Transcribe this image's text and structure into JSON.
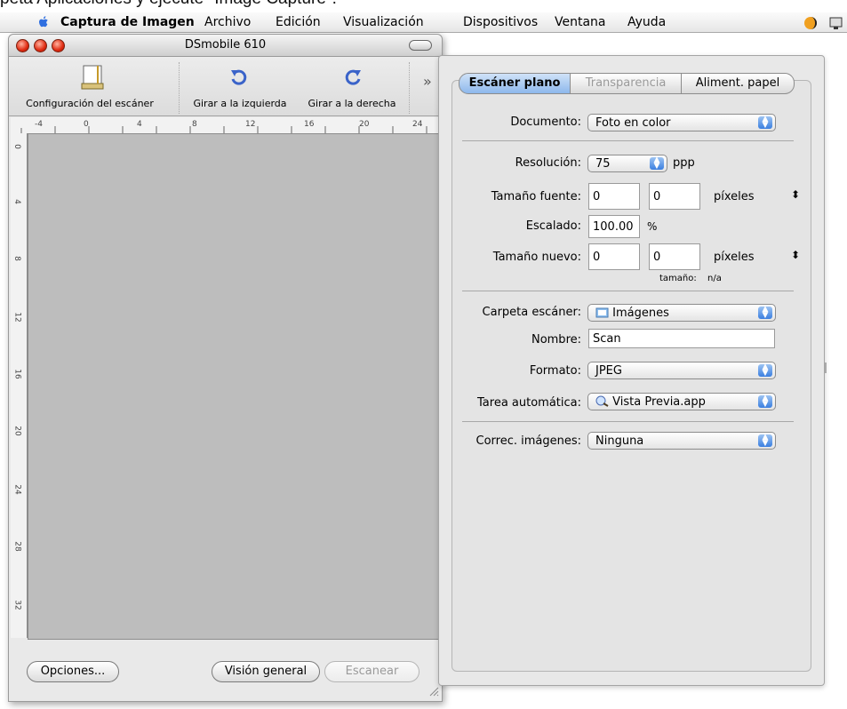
{
  "caption": "peta Aplicaciones y ejecute \"Image Capture\".",
  "menubar": {
    "app": "Captura de Imagen",
    "items": [
      "Archivo",
      "Edición",
      "Visualización",
      "Dispositivos",
      "Ventana",
      "Ayuda"
    ]
  },
  "scanner_window": {
    "title": "DSmobile 610",
    "toolbar": {
      "config": "Configuración del escáner",
      "rotate_left": "Girar a la izquierda",
      "rotate_right": "Girar a la derecha",
      "more": "»"
    },
    "ruler_top": [
      "-4",
      "0",
      "4",
      "8",
      "12",
      "16",
      "20",
      "24"
    ],
    "ruler_left": [
      "0",
      "4",
      "8",
      "12",
      "16",
      "20",
      "24",
      "28",
      "32"
    ],
    "buttons": {
      "options": "Opciones...",
      "overview": "Visión general",
      "scan": "Escanear"
    }
  },
  "settings": {
    "tabs": [
      "Escáner plano",
      "Transparencia",
      "Aliment. papel"
    ],
    "selected_tab": "Escáner plano",
    "document_label": "Documento:",
    "document_value": "Foto en color",
    "resolution_label": "Resolución:",
    "resolution_value": "75",
    "resolution_unit": "ppp",
    "source_size_label": "Tamaño fuente:",
    "source_w": "0",
    "source_h": "0",
    "source_unit": "píxeles",
    "scale_label": "Escalado:",
    "scale_value": "100.00",
    "scale_unit": "%",
    "new_size_label": "Tamaño nuevo:",
    "new_w": "0",
    "new_h": "0",
    "new_unit": "píxeles",
    "size_label": "tamaño:",
    "size_value": "n/a",
    "folder_label": "Carpeta escáner:",
    "folder_value": "Imágenes",
    "name_label": "Nombre:",
    "name_value": "Scan",
    "format_label": "Formato:",
    "format_value": "JPEG",
    "task_label": "Tarea automática:",
    "task_value": "Vista Previa.app",
    "correction_label": "Correc. imágenes:",
    "correction_value": "Ninguna"
  }
}
